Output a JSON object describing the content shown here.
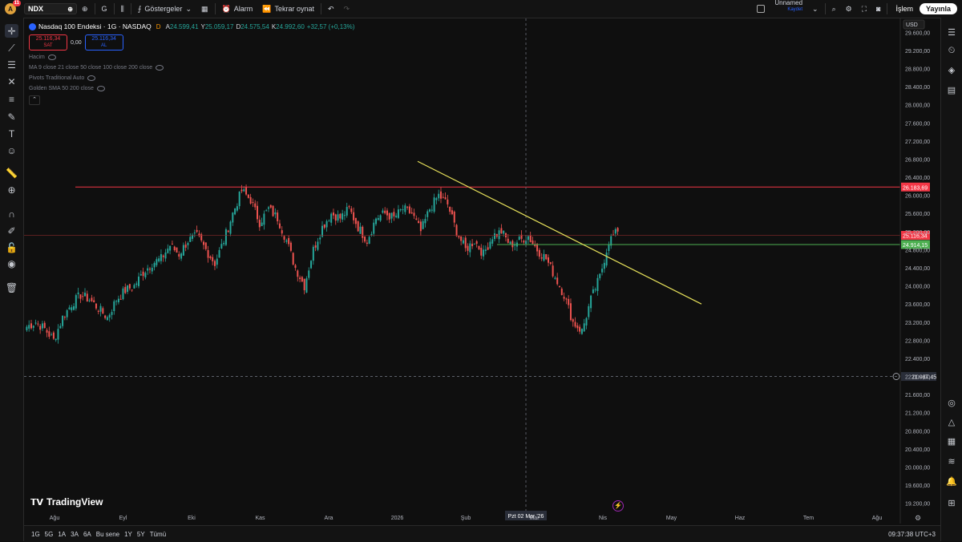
{
  "topbar": {
    "avatar_letter": "A",
    "notif_count": "11",
    "symbol": "NDX",
    "interval": "G",
    "indicators_label": "Göstergeler",
    "alert_label": "Alarm",
    "replay_label": "Tekrar oynat",
    "layout_name": "Unnamed",
    "layout_status": "Kaydet",
    "trade_label": "İşlem",
    "publish_label": "Yayınla"
  },
  "legend": {
    "title": "Nasdaq 100 Endeksi · 1G · NASDAQ",
    "d_badge": "D",
    "o_label": "A",
    "o_val": "24.599,41",
    "h_label": "Y",
    "h_val": "25.059,17",
    "l_label": "D",
    "l_val": "24.575,54",
    "c_label": "K",
    "c_val": "24.992,60",
    "change": "+32,57 (+0,13%)",
    "sell_price": "25.116,34",
    "sell_label": "SAT",
    "spread": "0,00",
    "buy_price": "25.116,34",
    "buy_label": "AL",
    "indicators": [
      "Hacim",
      "MA 9 close 21 close 50 close 100 close 200 close",
      "Pivots Traditional Auto",
      "Golden SMA 50 200 close"
    ]
  },
  "currency": "USD",
  "axis": {
    "y_labels": [
      "29.600,00",
      "29.200,00",
      "28.800,00",
      "28.400,00",
      "28.000,00",
      "27.600,00",
      "27.200,00",
      "26.800,00",
      "26.400,00",
      "26.000,00",
      "25.600,00",
      "25.200,00",
      "24.800,00",
      "24.400,00",
      "24.000,00",
      "23.600,00",
      "23.200,00",
      "22.800,00",
      "22.400,00",
      "22.000,00",
      "21.600,00",
      "21.200,00",
      "20.800,00",
      "20.400,00",
      "20.000,00",
      "19.600,00",
      "19.200,00"
    ],
    "x_labels": [
      "Ağu",
      "Eyl",
      "Eki",
      "Kas",
      "Ara",
      "2026",
      "Şub",
      "Mar",
      "Nis",
      "May",
      "Haz",
      "Tem",
      "Ağu"
    ],
    "crosshair_date": "Pzt 02 Mar '26",
    "crosshair_price": "21.987,45"
  },
  "price_tags": {
    "resistance": "26.183,69",
    "current": "25.116,34",
    "support": "24.914,15"
  },
  "colors": {
    "up": "#26a69a",
    "down": "#ef5350",
    "resistance": "#f23645",
    "support": "#4caf50",
    "trend": "#e6e05a"
  },
  "chart_data": {
    "type": "candlestick",
    "title": "Nasdaq 100 Endeksi · 1G · NASDAQ",
    "ylim": [
      19000,
      29800
    ],
    "levels": {
      "resistance": 26183.69,
      "support": 24914.15,
      "current": 25116.34
    },
    "closes_approx": [
      23100,
      23200,
      23050,
      22800,
      23300,
      23600,
      23800,
      23700,
      23500,
      23300,
      23700,
      23900,
      24000,
      24300,
      24500,
      24600,
      24900,
      24700,
      25000,
      25100,
      24800,
      24500,
      25000,
      25600,
      26100,
      25900,
      25400,
      25700,
      25500,
      25000,
      24400,
      24000,
      24800,
      25300,
      25600,
      25500,
      25700,
      25300,
      25000,
      25500,
      25600,
      25500,
      25700,
      25600,
      25200,
      25700,
      26000,
      25800,
      25200,
      24800,
      25000,
      24700,
      25100,
      25200,
      24900,
      25000,
      25100,
      24800,
      24600,
      24200,
      23800,
      23200,
      23000,
      23700,
      24200,
      25000,
      25200
    ],
    "trendline": {
      "from": {
        "x": "Oca",
        "y": 26750
      },
      "to": {
        "x": "Nis",
        "y": 23600
      }
    }
  },
  "bottombar": {
    "ranges": [
      "1G",
      "5G",
      "1A",
      "3A",
      "6A",
      "Bu sene",
      "1Y",
      "5Y",
      "Tümü"
    ],
    "time": "09:37:38 UTC+3"
  },
  "branding": "TradingView"
}
